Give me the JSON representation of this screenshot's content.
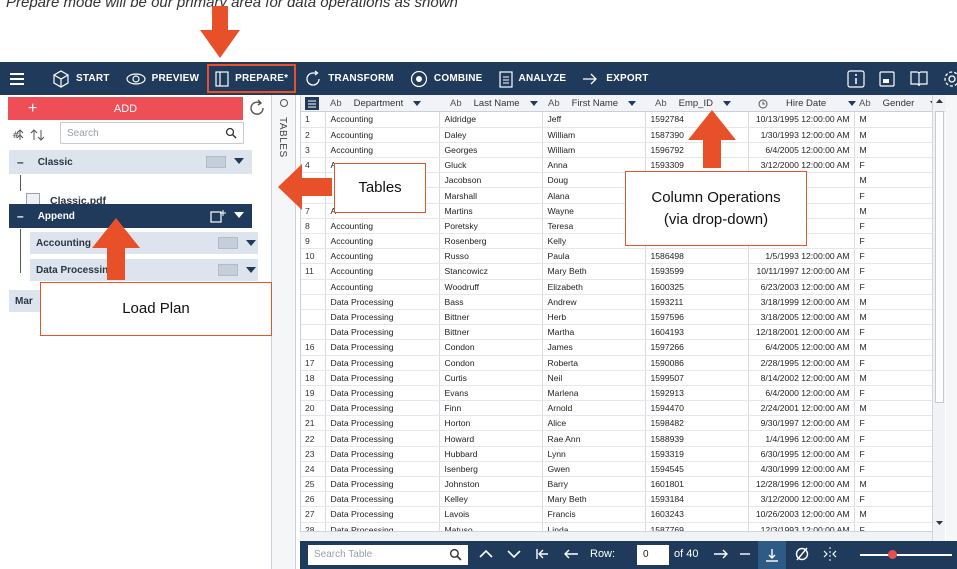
{
  "caption": "Prepare mode will be our primary area for data operations as shown",
  "toolbar": {
    "items": [
      {
        "label": "START",
        "icon": "cube-icon"
      },
      {
        "label": "PREVIEW",
        "icon": "eye-icon"
      },
      {
        "label": "PREPARE*",
        "icon": "columns-icon",
        "active": true
      },
      {
        "label": "TRANSFORM",
        "icon": "refresh-icon"
      },
      {
        "label": "COMBINE",
        "icon": "combine-icon"
      },
      {
        "label": "ANALYZE",
        "icon": "clipboard-icon"
      },
      {
        "label": "EXPORT",
        "icon": "export-icon"
      }
    ],
    "colors": {
      "bar": "#1f3a5a",
      "highlight": "#e8502a"
    }
  },
  "left_panel": {
    "add_label": "ADD",
    "search_placeholder": "Search",
    "classic_group": "Classic",
    "file_name": "Classic.pdf",
    "append_group": "Append",
    "append_children": [
      "Accounting",
      "Data Processing"
    ],
    "other_group": "Mar"
  },
  "tables_tab_label": "TABLES",
  "grid": {
    "headers": [
      {
        "type": "Ab",
        "label": "Department"
      },
      {
        "type": "Ab",
        "label": "Last Name"
      },
      {
        "type": "Ab",
        "label": "First Name"
      },
      {
        "type": "Ab",
        "label": "Emp_ID"
      },
      {
        "type": "clock",
        "label": "Hire Date"
      },
      {
        "type": "Ab",
        "label": "Gender"
      }
    ],
    "rows": [
      [
        "1",
        "Accounting",
        "Aldridge",
        "Jeff",
        "1592784",
        "10/13/1995 12:00:00 AM",
        "M"
      ],
      [
        "2",
        "Accounting",
        "Daley",
        "William",
        "1587390",
        "1/30/1993 12:00:00 AM",
        "M"
      ],
      [
        "3",
        "Accounting",
        "Georges",
        "William",
        "1596792",
        "6/4/2005 12:00:00 AM",
        "M"
      ],
      [
        "4",
        "A",
        "Gluck",
        "Anna",
        "1593309",
        "3/12/2000 12:00:00 AM",
        "F"
      ],
      [
        "",
        "",
        "Jacobson",
        "Doug",
        "",
        "",
        "M"
      ],
      [
        "",
        "",
        "Marshall",
        "Alana",
        "",
        "",
        "F"
      ],
      [
        "7",
        "A",
        "Martins",
        "Wayne",
        "",
        "",
        "M"
      ],
      [
        "8",
        "Accounting",
        "Poretsky",
        "Teresa",
        "",
        "",
        "F"
      ],
      [
        "9",
        "Accounting",
        "Rosenberg",
        "Kelly",
        "",
        "",
        "F"
      ],
      [
        "10",
        "Accounting",
        "Russo",
        "Paula",
        "1586498",
        "1/5/1993 12:00:00 AM",
        "F"
      ],
      [
        "11",
        "Accounting",
        "Stancowicz",
        "Mary Beth",
        "1593599",
        "10/11/1997 12:00:00 AM",
        "F"
      ],
      [
        "",
        "Accounting",
        "Woodruff",
        "Elizabeth",
        "1600325",
        "6/23/2003 12:00:00 AM",
        "F"
      ],
      [
        "",
        "Data Processing",
        "Bass",
        "Andrew",
        "1593211",
        "3/18/1999 12:00:00 AM",
        "M"
      ],
      [
        "",
        "Data Processing",
        "Bittner",
        "Herb",
        "1597596",
        "3/18/2005 12:00:00 AM",
        "M"
      ],
      [
        "",
        "Data Processing",
        "Bittner",
        "Martha",
        "1604193",
        "12/18/2001 12:00:00 AM",
        "F"
      ],
      [
        "16",
        "Data Processing",
        "Condon",
        "James",
        "1597266",
        "6/4/2005 12:00:00 AM",
        "M"
      ],
      [
        "17",
        "Data Processing",
        "Condon",
        "Roberta",
        "1590086",
        "2/28/1995 12:00:00 AM",
        "F"
      ],
      [
        "18",
        "Data Processing",
        "Curtis",
        "Neil",
        "1599507",
        "8/14/2002 12:00:00 AM",
        "M"
      ],
      [
        "19",
        "Data Processing",
        "Evans",
        "Marlena",
        "1592913",
        "6/4/2000 12:00:00 AM",
        "F"
      ],
      [
        "20",
        "Data Processing",
        "Finn",
        "Arnold",
        "1594470",
        "2/24/2001 12:00:00 AM",
        "M"
      ],
      [
        "21",
        "Data Processing",
        "Horton",
        "Alice",
        "1598482",
        "9/30/1997 12:00:00 AM",
        "F"
      ],
      [
        "22",
        "Data Processing",
        "Howard",
        "Rae Ann",
        "1588939",
        "1/4/1996 12:00:00 AM",
        "F"
      ],
      [
        "23",
        "Data Processing",
        "Hubbard",
        "Lynn",
        "1593319",
        "6/30/1995 12:00:00 AM",
        "F"
      ],
      [
        "24",
        "Data Processing",
        "Isenberg",
        "Gwen",
        "1594545",
        "4/30/1999 12:00:00 AM",
        "F"
      ],
      [
        "25",
        "Data Processing",
        "Johnston",
        "Barry",
        "1601801",
        "12/28/1996 12:00:00 AM",
        "M"
      ],
      [
        "26",
        "Data Processing",
        "Kelley",
        "Mary Beth",
        "1593184",
        "3/12/2000 12:00:00 AM",
        "F"
      ],
      [
        "27",
        "Data Processing",
        "Lavois",
        "Francis",
        "1603243",
        "10/26/2003 12:00:00 AM",
        "M"
      ],
      [
        "28",
        "Data Processing",
        "Matuso",
        "Linda",
        "1587769",
        "12/3/1993 12:00:00 AM",
        "F"
      ]
    ]
  },
  "bottom_bar": {
    "search_placeholder": "Search Table",
    "row_label": "Row:",
    "row_value": "0",
    "of_label": "of 40"
  },
  "annotations": {
    "tables": "Tables",
    "column_ops_line1": "Column Operations",
    "column_ops_line2": "(via drop-down)",
    "load_plan": "Load Plan",
    "color": "#e8502a"
  }
}
